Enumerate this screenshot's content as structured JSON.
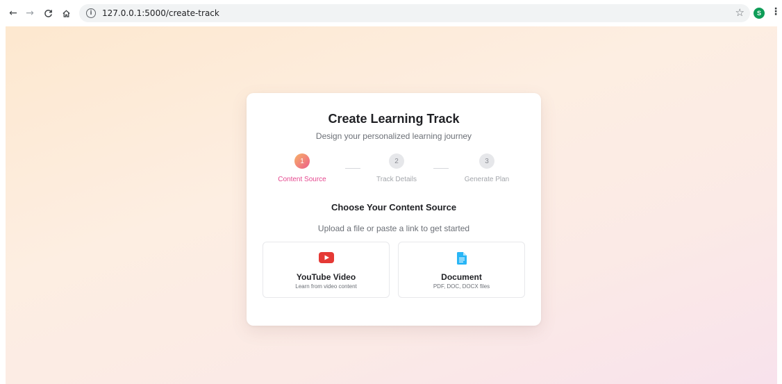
{
  "browser": {
    "url": "127.0.0.1:5000/create-track",
    "profile_initial": "S",
    "icons": [
      "back-arrow-icon",
      "forward-arrow-icon",
      "reload-icon",
      "home-icon",
      "info-icon",
      "star-icon",
      "kebab-menu-icon"
    ]
  },
  "card": {
    "title": "Create Learning Track",
    "subtitle": "Design your personalized learning journey"
  },
  "stepper": {
    "steps": [
      {
        "number": "1",
        "label": "Content Source",
        "active": true
      },
      {
        "number": "2",
        "label": "Track Details",
        "active": false
      },
      {
        "number": "3",
        "label": "Generate Plan",
        "active": false
      }
    ]
  },
  "content_source": {
    "title": "Choose Your Content Source",
    "subtitle": "Upload a file or paste a link to get started",
    "options": [
      {
        "label": "YouTube Video",
        "description": "Learn from video content",
        "icon": "youtube-icon"
      },
      {
        "label": "Document",
        "description": "PDF, DOC, DOCX files",
        "icon": "document-icon"
      }
    ]
  },
  "colors": {
    "accent_pink": "#e5488f",
    "accent_orange": "#f7b267",
    "youtube_red": "#e53935",
    "document_blue": "#29b6f6"
  }
}
